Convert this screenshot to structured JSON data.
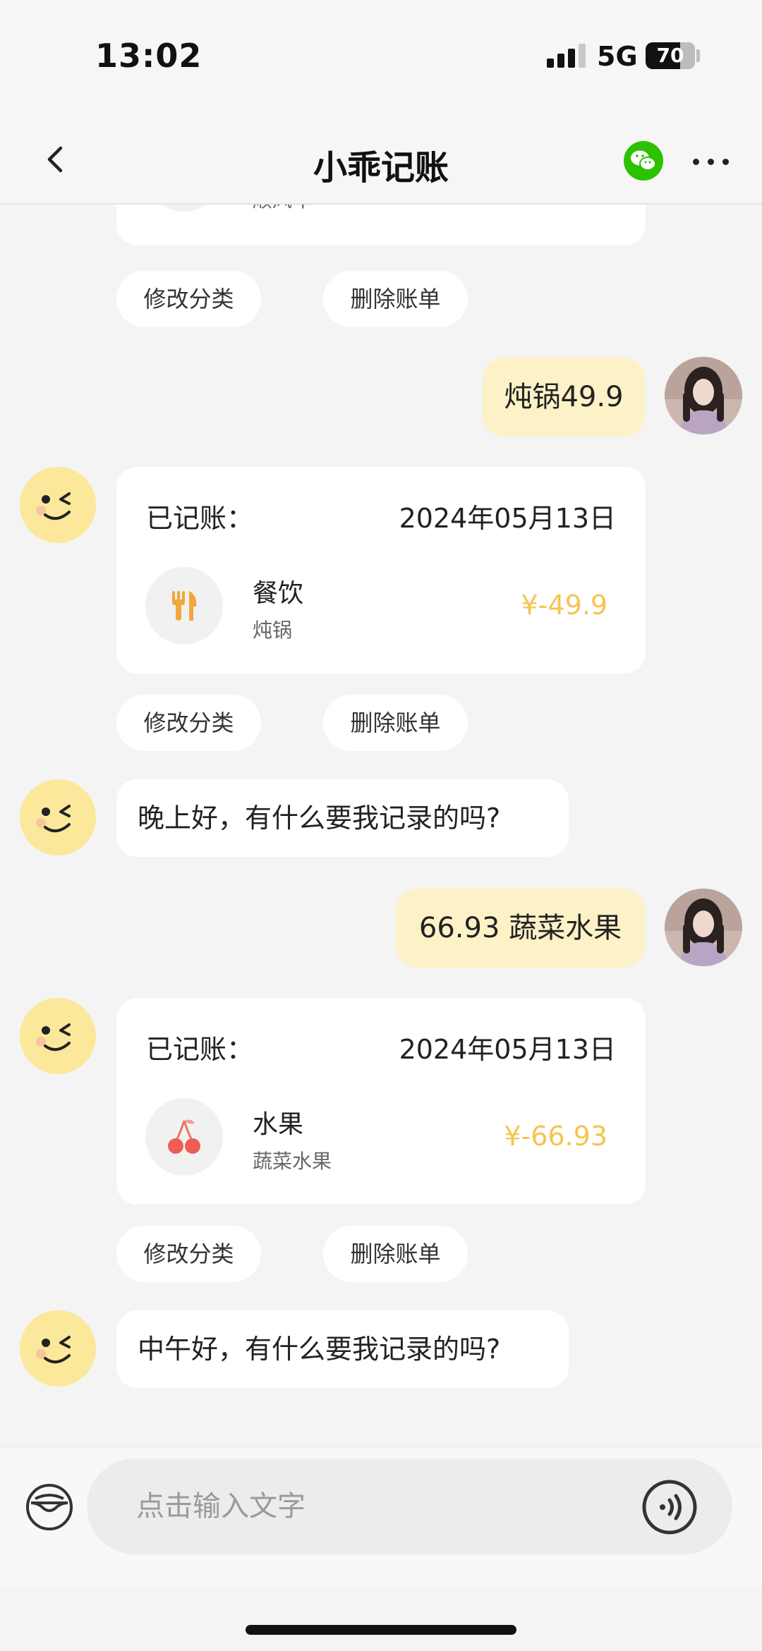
{
  "status_bar": {
    "time": "13:02",
    "network": "5G",
    "battery": "70",
    "battery_fraction": 0.7
  },
  "nav": {
    "title": "小乖记账",
    "back_icon": "chevron-left-icon",
    "wechat_icon": "wechat-icon",
    "more_icon": "more-dots-icon"
  },
  "messages": {
    "top_card": {
      "note": "顺风车"
    },
    "top_actions": {
      "edit": "修改分类",
      "delete": "删除账单"
    },
    "user_1": "炖锅49.9",
    "card_1": {
      "label": "已记账：",
      "date": "2024年05月13日",
      "category": "餐饮",
      "note": "炖锅",
      "amount": "¥-49.9",
      "icon": "fork-knife-icon",
      "edit": "修改分类",
      "delete": "删除账单"
    },
    "bot_1": "晚上好，有什么要我记录的吗?",
    "user_2": "66.93 蔬菜水果",
    "card_2": {
      "label": "已记账：",
      "date": "2024年05月13日",
      "category": "水果",
      "note": "蔬菜水果",
      "amount": "¥-66.93",
      "icon": "cherry-icon",
      "edit": "修改分类",
      "delete": "删除账单"
    },
    "bot_2": "中午好，有什么要我记录的吗?"
  },
  "input": {
    "placeholder": "点击输入文字",
    "wallet_icon": "wallet-icon",
    "voice_icon": "voice-icon"
  },
  "colors": {
    "amount": "#f6c451",
    "user_bubble": "#fdf1c7",
    "wechat": "#2dc100",
    "background": "#f4f4f4"
  }
}
